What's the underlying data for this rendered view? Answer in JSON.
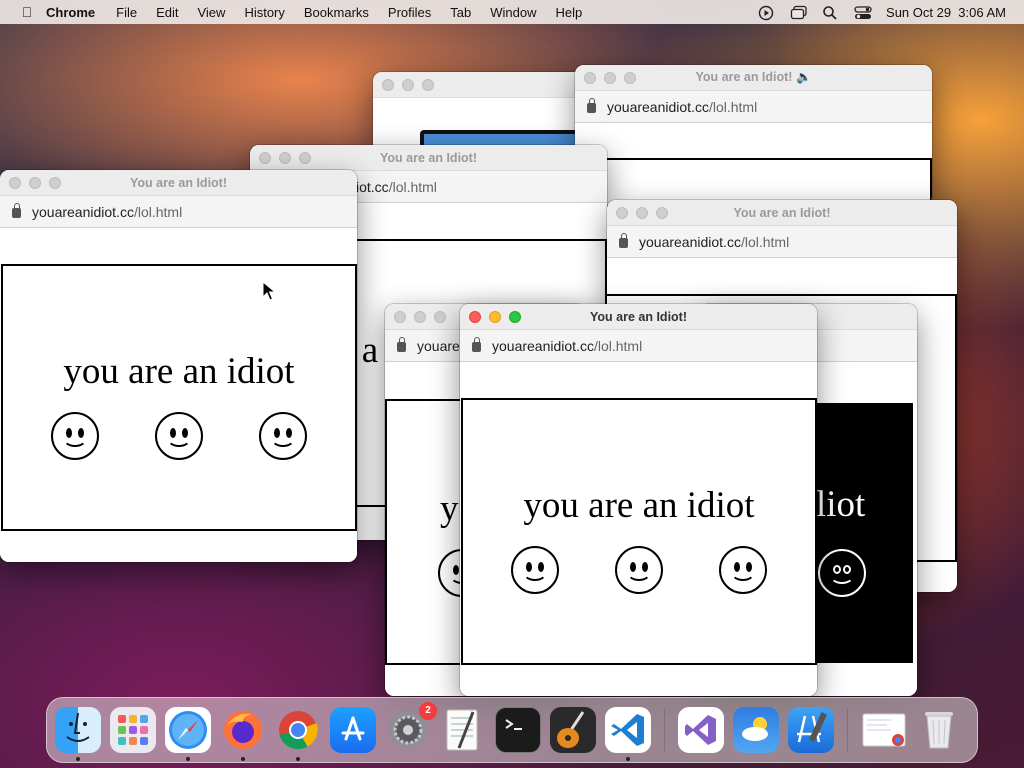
{
  "menubar": {
    "app_name": "Chrome",
    "items": [
      "File",
      "Edit",
      "View",
      "History",
      "Bookmarks",
      "Profiles",
      "Tab",
      "Window",
      "Help"
    ],
    "datetime": "Sun Oct 29  3:06 AM"
  },
  "window": {
    "title": "You are an Idiot!",
    "title_with_sound": "You are an Idiot! 🔈",
    "url_host": "youareanidiot.cc",
    "url_path": "/lol.html",
    "url_partial_host": "iot.cc",
    "url_partial_short": "youare"
  },
  "page": {
    "message": "you are an idiot",
    "message_partial_start": "y",
    "message_partial_mid": "u a",
    "message_partial_end": "liot"
  },
  "dock": {
    "apps": [
      {
        "name": "Finder",
        "icon": "finder-icon",
        "running": true
      },
      {
        "name": "Launchpad",
        "icon": "launchpad-icon",
        "running": false
      },
      {
        "name": "Safari",
        "icon": "safari-icon",
        "running": true
      },
      {
        "name": "Firefox",
        "icon": "firefox-icon",
        "running": true
      },
      {
        "name": "Chrome",
        "icon": "chrome-icon",
        "running": true
      },
      {
        "name": "App Store",
        "icon": "app-store-icon",
        "running": false
      },
      {
        "name": "System Preferences",
        "icon": "system-preferences-icon",
        "running": false,
        "badge": "2"
      },
      {
        "name": "TextEdit",
        "icon": "textedit-icon",
        "running": false
      },
      {
        "name": "Terminal",
        "icon": "terminal-icon",
        "running": false
      },
      {
        "name": "GarageBand",
        "icon": "garageband-icon",
        "running": false
      },
      {
        "name": "Visual Studio Code",
        "icon": "vscode-icon",
        "running": true
      },
      {
        "name": "Visual Studio",
        "icon": "visual-studio-icon",
        "running": false
      },
      {
        "name": "Weather",
        "icon": "weather-icon",
        "running": false
      },
      {
        "name": "Xcode",
        "icon": "xcode-icon",
        "running": false
      },
      {
        "name": "Chrome Document",
        "icon": "chrome-document-icon",
        "running": false
      },
      {
        "name": "Trash",
        "icon": "trash-icon",
        "running": false
      }
    ],
    "badge_system_preferences": "2"
  }
}
